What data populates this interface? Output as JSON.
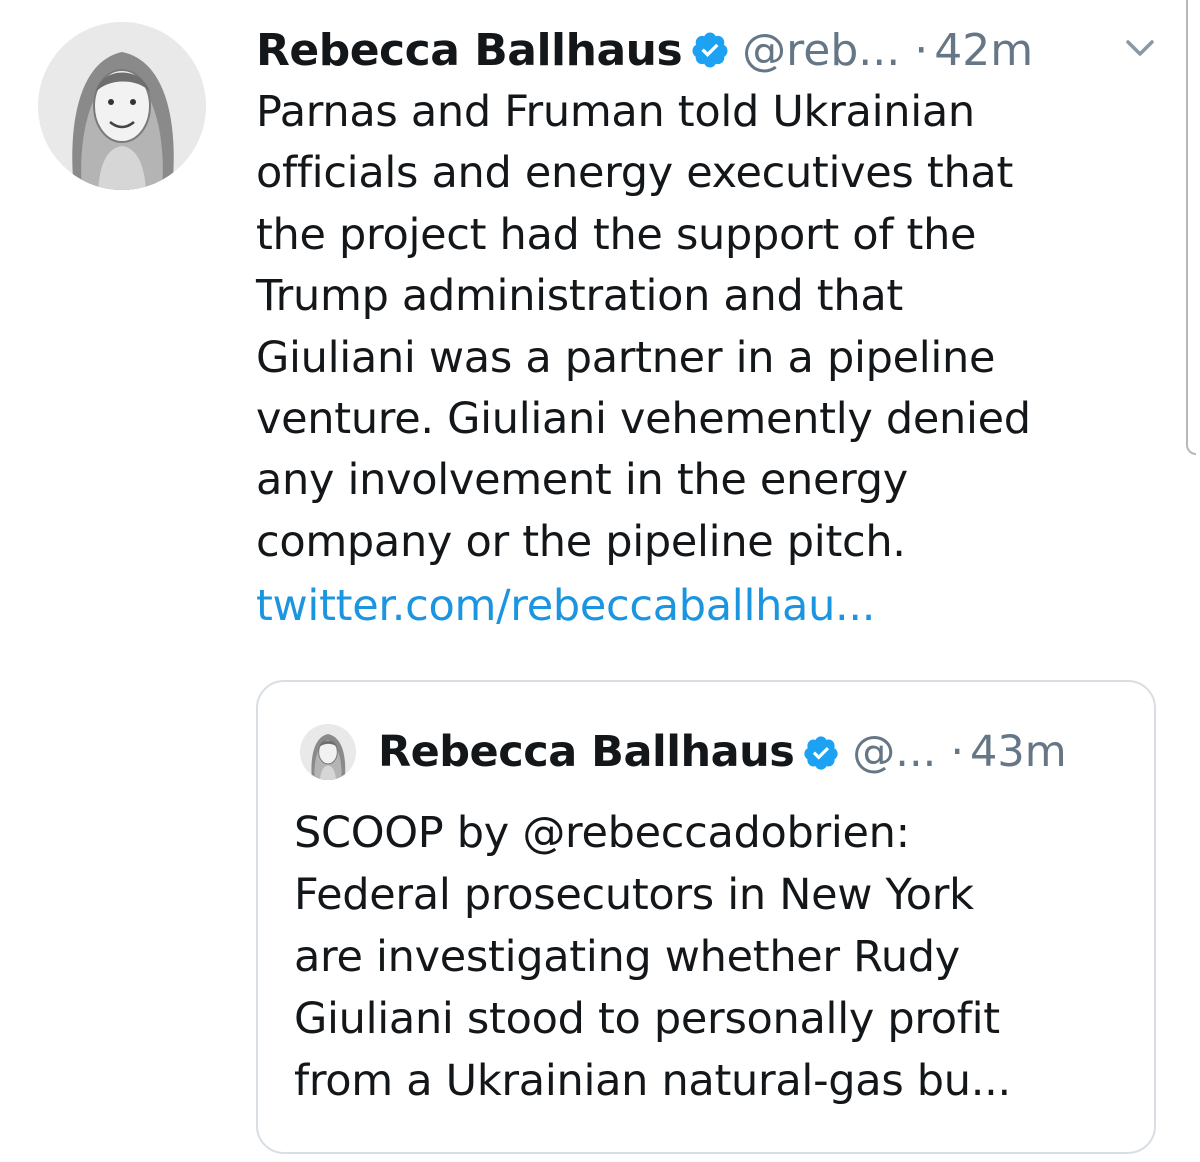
{
  "tweet": {
    "author_name": "Rebecca Ballhaus",
    "handle": "@reb...",
    "separator": "·",
    "time": "42m",
    "text": "Parnas and Fruman told Ukrainian\nofficials and energy executives that\nthe project had the support of the\nTrump administration and that\nGiuliani was a partner in a pipeline\nventure. Giuliani vehemently denied\nany involvement in the energy\ncompany or the pipeline pitch.",
    "link": "twitter.com/rebeccaballhau..."
  },
  "quoted_tweet": {
    "author_name": "Rebecca Ballhaus",
    "handle": "@...",
    "separator": "·",
    "time": "43m",
    "text": "SCOOP by @rebeccadobrien:\nFederal prosecutors in New York\nare investigating whether Rudy\nGiuliani stood to personally profit\nfrom a Ukrainian natural-gas bu..."
  },
  "icons": {
    "verified": "verified-badge-icon",
    "menu": "chevron-down-icon"
  },
  "colors": {
    "text": "#14171a",
    "secondary": "#657786",
    "link": "#1b95e0",
    "verified": "#1da1f2",
    "border": "#d8dee3"
  }
}
